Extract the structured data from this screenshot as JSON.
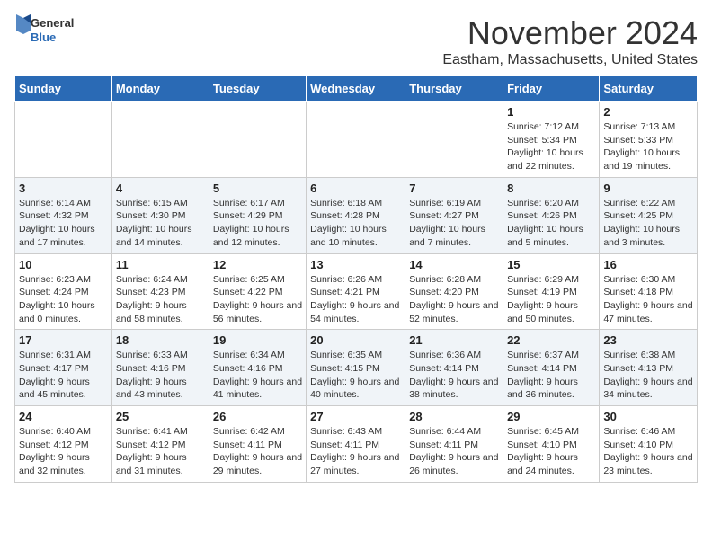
{
  "logo": {
    "general": "General",
    "blue": "Blue"
  },
  "title": "November 2024",
  "location": "Eastham, Massachusetts, United States",
  "days_header": [
    "Sunday",
    "Monday",
    "Tuesday",
    "Wednesday",
    "Thursday",
    "Friday",
    "Saturday"
  ],
  "weeks": [
    [
      {
        "day": "",
        "detail": ""
      },
      {
        "day": "",
        "detail": ""
      },
      {
        "day": "",
        "detail": ""
      },
      {
        "day": "",
        "detail": ""
      },
      {
        "day": "",
        "detail": ""
      },
      {
        "day": "1",
        "detail": "Sunrise: 7:12 AM\nSunset: 5:34 PM\nDaylight: 10 hours and 22 minutes."
      },
      {
        "day": "2",
        "detail": "Sunrise: 7:13 AM\nSunset: 5:33 PM\nDaylight: 10 hours and 19 minutes."
      }
    ],
    [
      {
        "day": "3",
        "detail": "Sunrise: 6:14 AM\nSunset: 4:32 PM\nDaylight: 10 hours and 17 minutes."
      },
      {
        "day": "4",
        "detail": "Sunrise: 6:15 AM\nSunset: 4:30 PM\nDaylight: 10 hours and 14 minutes."
      },
      {
        "day": "5",
        "detail": "Sunrise: 6:17 AM\nSunset: 4:29 PM\nDaylight: 10 hours and 12 minutes."
      },
      {
        "day": "6",
        "detail": "Sunrise: 6:18 AM\nSunset: 4:28 PM\nDaylight: 10 hours and 10 minutes."
      },
      {
        "day": "7",
        "detail": "Sunrise: 6:19 AM\nSunset: 4:27 PM\nDaylight: 10 hours and 7 minutes."
      },
      {
        "day": "8",
        "detail": "Sunrise: 6:20 AM\nSunset: 4:26 PM\nDaylight: 10 hours and 5 minutes."
      },
      {
        "day": "9",
        "detail": "Sunrise: 6:22 AM\nSunset: 4:25 PM\nDaylight: 10 hours and 3 minutes."
      }
    ],
    [
      {
        "day": "10",
        "detail": "Sunrise: 6:23 AM\nSunset: 4:24 PM\nDaylight: 10 hours and 0 minutes."
      },
      {
        "day": "11",
        "detail": "Sunrise: 6:24 AM\nSunset: 4:23 PM\nDaylight: 9 hours and 58 minutes."
      },
      {
        "day": "12",
        "detail": "Sunrise: 6:25 AM\nSunset: 4:22 PM\nDaylight: 9 hours and 56 minutes."
      },
      {
        "day": "13",
        "detail": "Sunrise: 6:26 AM\nSunset: 4:21 PM\nDaylight: 9 hours and 54 minutes."
      },
      {
        "day": "14",
        "detail": "Sunrise: 6:28 AM\nSunset: 4:20 PM\nDaylight: 9 hours and 52 minutes."
      },
      {
        "day": "15",
        "detail": "Sunrise: 6:29 AM\nSunset: 4:19 PM\nDaylight: 9 hours and 50 minutes."
      },
      {
        "day": "16",
        "detail": "Sunrise: 6:30 AM\nSunset: 4:18 PM\nDaylight: 9 hours and 47 minutes."
      }
    ],
    [
      {
        "day": "17",
        "detail": "Sunrise: 6:31 AM\nSunset: 4:17 PM\nDaylight: 9 hours and 45 minutes."
      },
      {
        "day": "18",
        "detail": "Sunrise: 6:33 AM\nSunset: 4:16 PM\nDaylight: 9 hours and 43 minutes."
      },
      {
        "day": "19",
        "detail": "Sunrise: 6:34 AM\nSunset: 4:16 PM\nDaylight: 9 hours and 41 minutes."
      },
      {
        "day": "20",
        "detail": "Sunrise: 6:35 AM\nSunset: 4:15 PM\nDaylight: 9 hours and 40 minutes."
      },
      {
        "day": "21",
        "detail": "Sunrise: 6:36 AM\nSunset: 4:14 PM\nDaylight: 9 hours and 38 minutes."
      },
      {
        "day": "22",
        "detail": "Sunrise: 6:37 AM\nSunset: 4:14 PM\nDaylight: 9 hours and 36 minutes."
      },
      {
        "day": "23",
        "detail": "Sunrise: 6:38 AM\nSunset: 4:13 PM\nDaylight: 9 hours and 34 minutes."
      }
    ],
    [
      {
        "day": "24",
        "detail": "Sunrise: 6:40 AM\nSunset: 4:12 PM\nDaylight: 9 hours and 32 minutes."
      },
      {
        "day": "25",
        "detail": "Sunrise: 6:41 AM\nSunset: 4:12 PM\nDaylight: 9 hours and 31 minutes."
      },
      {
        "day": "26",
        "detail": "Sunrise: 6:42 AM\nSunset: 4:11 PM\nDaylight: 9 hours and 29 minutes."
      },
      {
        "day": "27",
        "detail": "Sunrise: 6:43 AM\nSunset: 4:11 PM\nDaylight: 9 hours and 27 minutes."
      },
      {
        "day": "28",
        "detail": "Sunrise: 6:44 AM\nSunset: 4:11 PM\nDaylight: 9 hours and 26 minutes."
      },
      {
        "day": "29",
        "detail": "Sunrise: 6:45 AM\nSunset: 4:10 PM\nDaylight: 9 hours and 24 minutes."
      },
      {
        "day": "30",
        "detail": "Sunrise: 6:46 AM\nSunset: 4:10 PM\nDaylight: 9 hours and 23 minutes."
      }
    ]
  ]
}
